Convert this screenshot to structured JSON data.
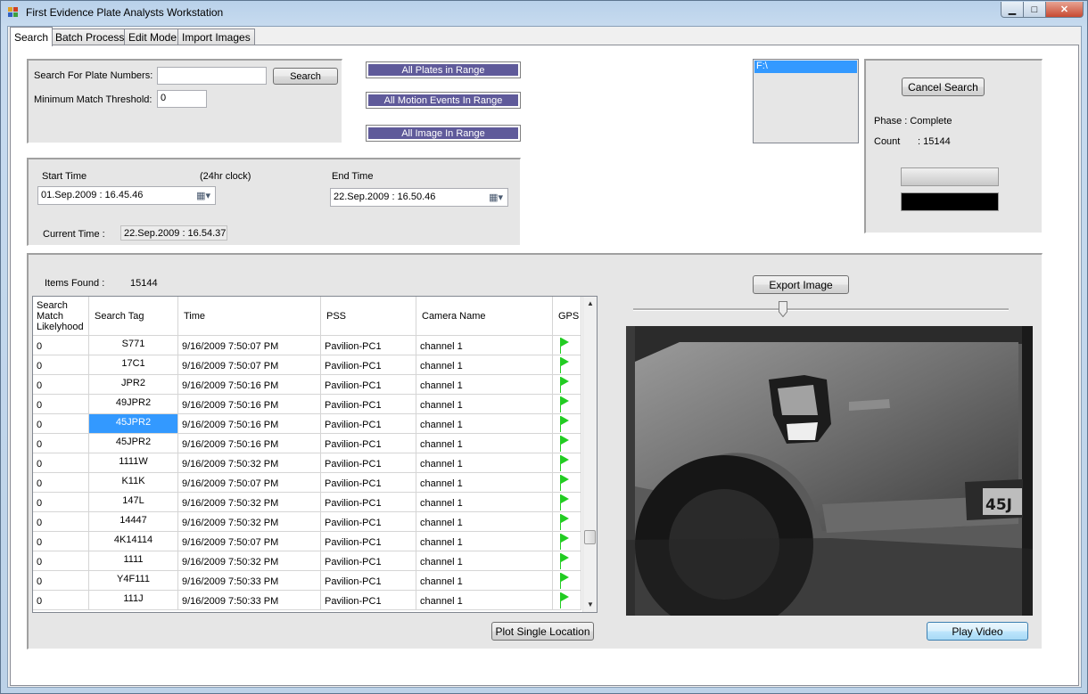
{
  "window": {
    "title": "First Evidence Plate Analysts Workstation",
    "minimize_glyph": "▁",
    "maximize_glyph": "□",
    "close_glyph": "✕"
  },
  "tabs": [
    {
      "label": "Search",
      "active": true
    },
    {
      "label": "Batch Process",
      "active": false
    },
    {
      "label": "Edit Mode",
      "active": false
    },
    {
      "label": "Import Images",
      "active": false
    }
  ],
  "search": {
    "plate_label": "Search For Plate Numbers:",
    "plate_value": "",
    "search_button": "Search",
    "threshold_label": "Minimum Match Threshold:",
    "threshold_value": "0"
  },
  "range_buttons": {
    "all_plates": "All Plates in Range",
    "all_motion": "All Motion Events In Range",
    "all_image": "All Image In Range"
  },
  "drives": [
    "F:\\"
  ],
  "time": {
    "start_label": "Start Time",
    "clock_note": "(24hr clock)",
    "start_value": "01.Sep.2009 : 16.45.46",
    "end_label": "End Time",
    "end_value": "22.Sep.2009 : 16.50.46",
    "current_label": "Current Time :",
    "current_value": "22.Sep.2009 : 16.54.37"
  },
  "status": {
    "cancel_button": "Cancel Search",
    "phase_label": "Phase : Complete",
    "count_label": "Count",
    "count_value": ": 15144",
    "progress_fraction": 1.0
  },
  "results": {
    "items_found_label": "Items Found :",
    "items_found_value": "15144",
    "columns": [
      "Search Match Likelyhood",
      "Search Tag",
      "Time",
      "PSS",
      "Camera Name",
      "GPS"
    ],
    "rows": [
      {
        "likelihood": "0",
        "tag": "S771",
        "time": "9/16/2009 7:50:07 PM",
        "pss": "Pavilion-PC1",
        "camera": "channel 1"
      },
      {
        "likelihood": "0",
        "tag": "17C1",
        "time": "9/16/2009 7:50:07 PM",
        "pss": "Pavilion-PC1",
        "camera": "channel 1"
      },
      {
        "likelihood": "0",
        "tag": "JPR2",
        "time": "9/16/2009 7:50:16 PM",
        "pss": "Pavilion-PC1",
        "camera": "channel 1"
      },
      {
        "likelihood": "0",
        "tag": "49JPR2",
        "time": "9/16/2009 7:50:16 PM",
        "pss": "Pavilion-PC1",
        "camera": "channel 1"
      },
      {
        "likelihood": "0",
        "tag": "45JPR2",
        "time": "9/16/2009 7:50:16 PM",
        "pss": "Pavilion-PC1",
        "camera": "channel 1",
        "selected": true
      },
      {
        "likelihood": "0",
        "tag": "45JPR2",
        "time": "9/16/2009 7:50:16 PM",
        "pss": "Pavilion-PC1",
        "camera": "channel 1"
      },
      {
        "likelihood": "0",
        "tag": "1111W",
        "time": "9/16/2009 7:50:32 PM",
        "pss": "Pavilion-PC1",
        "camera": "channel 1"
      },
      {
        "likelihood": "0",
        "tag": "K11K",
        "time": "9/16/2009 7:50:07 PM",
        "pss": "Pavilion-PC1",
        "camera": "channel 1"
      },
      {
        "likelihood": "0",
        "tag": "147L",
        "time": "9/16/2009 7:50:32 PM",
        "pss": "Pavilion-PC1",
        "camera": "channel 1"
      },
      {
        "likelihood": "0",
        "tag": "14447",
        "time": "9/16/2009 7:50:32 PM",
        "pss": "Pavilion-PC1",
        "camera": "channel 1"
      },
      {
        "likelihood": "0",
        "tag": "4K14114",
        "time": "9/16/2009 7:50:07 PM",
        "pss": "Pavilion-PC1",
        "camera": "channel 1"
      },
      {
        "likelihood": "0",
        "tag": "1111",
        "time": "9/16/2009 7:50:32 PM",
        "pss": "Pavilion-PC1",
        "camera": "channel 1"
      },
      {
        "likelihood": "0",
        "tag": "Y4F111",
        "time": "9/16/2009 7:50:33 PM",
        "pss": "Pavilion-PC1",
        "camera": "channel 1"
      },
      {
        "likelihood": "0",
        "tag": "111J",
        "time": "9/16/2009 7:50:33 PM",
        "pss": "Pavilion-PC1",
        "camera": "channel 1"
      }
    ],
    "plot_button": "Plot Single Location"
  },
  "viewer": {
    "export_button": "Export Image",
    "slider_fraction": 0.4,
    "play_button": "Play Video",
    "plate_text": "45J"
  },
  "colors": {
    "range_button_bg": "#5f5a9a",
    "selection": "#3399ff",
    "gps_flag": "#22cc22"
  }
}
